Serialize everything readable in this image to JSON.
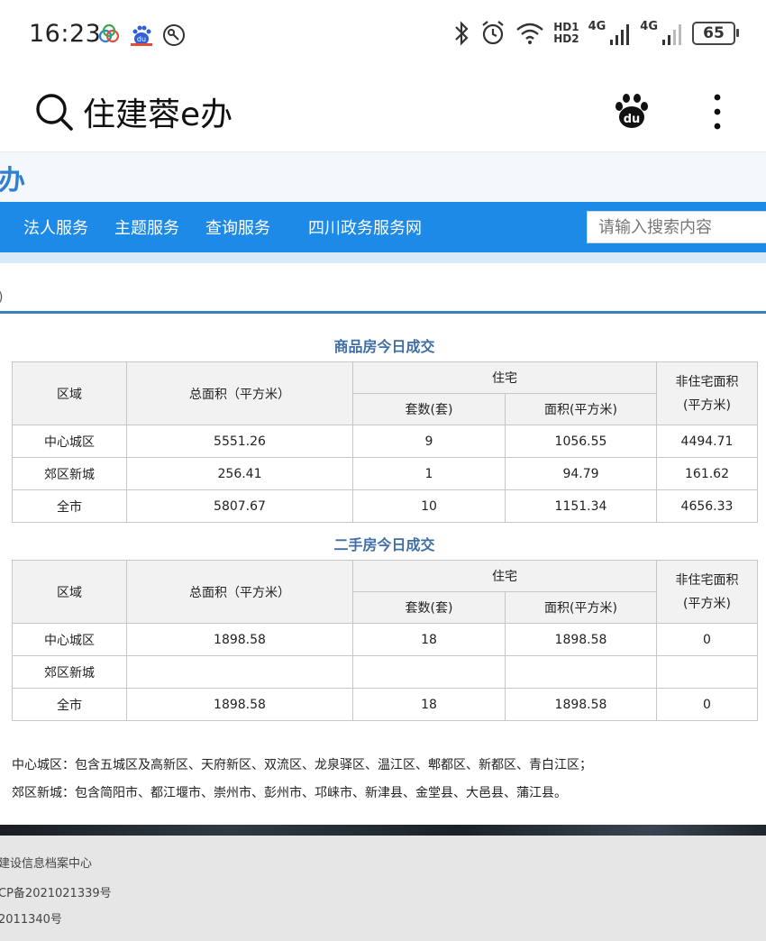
{
  "status_bar": {
    "time": "16:23",
    "hd1": "HD1",
    "hd2": "HD2",
    "net1": "4G",
    "net2": "4G",
    "battery": "65"
  },
  "browser": {
    "title": "住建蓉e办",
    "icons": [
      "search-icon",
      "baidu-icon",
      "more-icon"
    ]
  },
  "site": {
    "logo_text": "办"
  },
  "nav": {
    "items": [
      "法人服务",
      "主题服务",
      "查询服务",
      "四川政务服务网"
    ],
    "search_placeholder": "请输入搜索内容"
  },
  "breadcrumb_fragment": ")",
  "tables": {
    "headers": {
      "region": "区域",
      "total_area": "总面积（平方米）",
      "residential": "住宅",
      "units": "套数(套)",
      "area": "面积(平方米)",
      "non_res_line1": "非住宅面积",
      "non_res_line2": "(平方米)"
    },
    "new_homes": {
      "title": "商品房今日成交",
      "rows": [
        {
          "region": "中心城区",
          "total": "5551.26",
          "units": "9",
          "area": "1056.55",
          "non_res": "4494.71"
        },
        {
          "region": "郊区新城",
          "total": "256.41",
          "units": "1",
          "area": "94.79",
          "non_res": "161.62"
        },
        {
          "region": "全市",
          "total": "5807.67",
          "units": "10",
          "area": "1151.34",
          "non_res": "4656.33"
        }
      ]
    },
    "resale": {
      "title": "二手房今日成交",
      "rows": [
        {
          "region": "中心城区",
          "total": "1898.58",
          "units": "18",
          "area": "1898.58",
          "non_res": "0"
        },
        {
          "region": "郊区新城",
          "total": "",
          "units": "",
          "area": "",
          "non_res": ""
        },
        {
          "region": "全市",
          "total": "1898.58",
          "units": "18",
          "area": "1898.58",
          "non_res": "0"
        }
      ]
    }
  },
  "notes": {
    "line1": "中心城区：包含五城区及高新区、天府新区、双流区、龙泉驿区、温江区、郫都区、新都区、青白江区；",
    "line2": "郊区新城：包含简阳市、都江堰市、崇州市、彭州市、邛崃市、新津县、金堂县、大邑县、蒲江县。"
  },
  "footer": {
    "line1": "建设信息档案中心",
    "line2": "CP备2021021339号",
    "line3": "2011340号"
  },
  "colors": {
    "nav_blue": "#1e8ae8",
    "title_blue": "#3f6fa6",
    "logo_blue": "#2f7fd3"
  }
}
